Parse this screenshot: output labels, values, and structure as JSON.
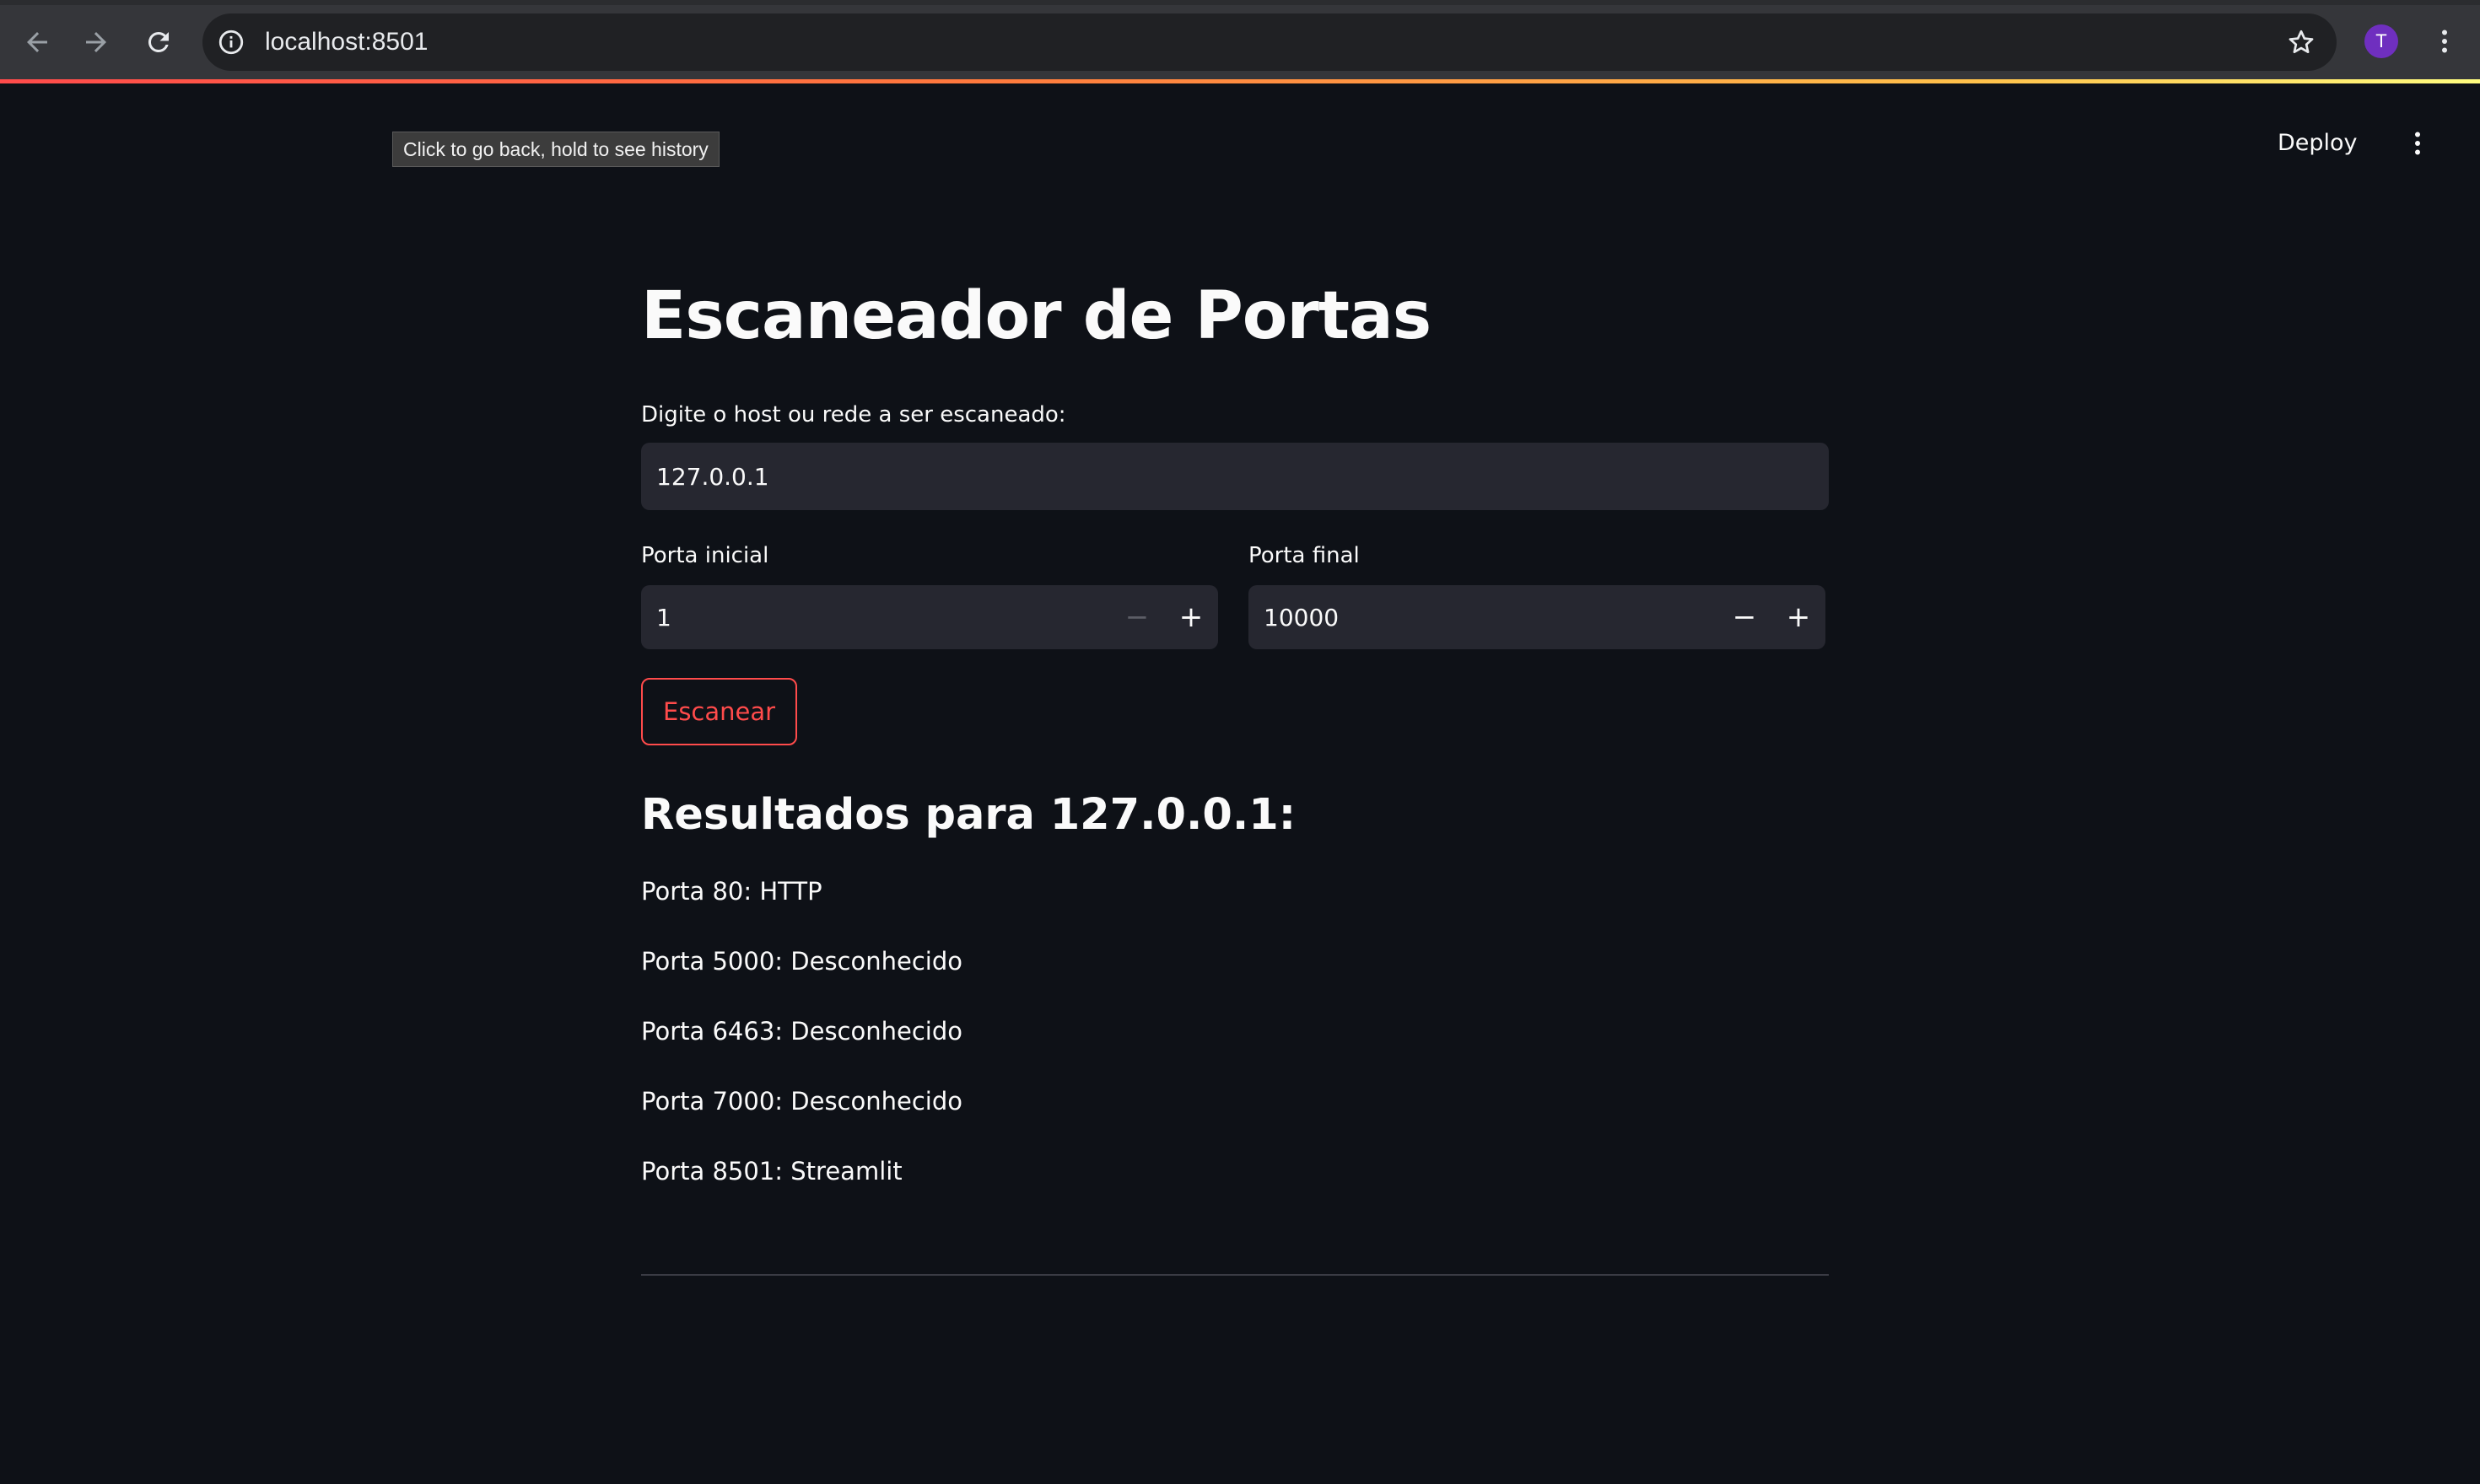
{
  "browser": {
    "url": "localhost:8501",
    "profile_initial": "T",
    "icons": {
      "back": "arrow-left-icon",
      "forward": "arrow-right-icon",
      "reload": "reload-icon",
      "site_info": "info-icon",
      "bookmark": "star-icon",
      "menu": "vertical-dots-icon"
    },
    "tooltip": "Click to go back, hold to see history"
  },
  "streamlit_header": {
    "deploy_label": "Deploy",
    "menu_icon": "vertical-dots-icon"
  },
  "app": {
    "title": "Escaneador de Portas",
    "host_input": {
      "label": "Digite o host ou rede a ser escaneado:",
      "value": "127.0.0.1"
    },
    "porta_inicial": {
      "label": "Porta inicial",
      "value": "1",
      "minus": "−",
      "plus": "+"
    },
    "porta_final": {
      "label": "Porta final",
      "value": "10000",
      "minus": "−",
      "plus": "+"
    },
    "scan_button_label": "Escanear",
    "results": {
      "title": "Resultados para 127.0.0.1:",
      "lines": [
        "Porta 80: HTTP",
        "Porta 5000: Desconhecido",
        "Porta 6463: Desconhecido",
        "Porta 7000: Desconhecido",
        "Porta 8501: Streamlit"
      ]
    }
  },
  "colors": {
    "background": "#0e1117",
    "input_background": "#262730",
    "accent": "#ff4b4b",
    "text": "#fafafa",
    "avatar": "#6f2fbf"
  }
}
